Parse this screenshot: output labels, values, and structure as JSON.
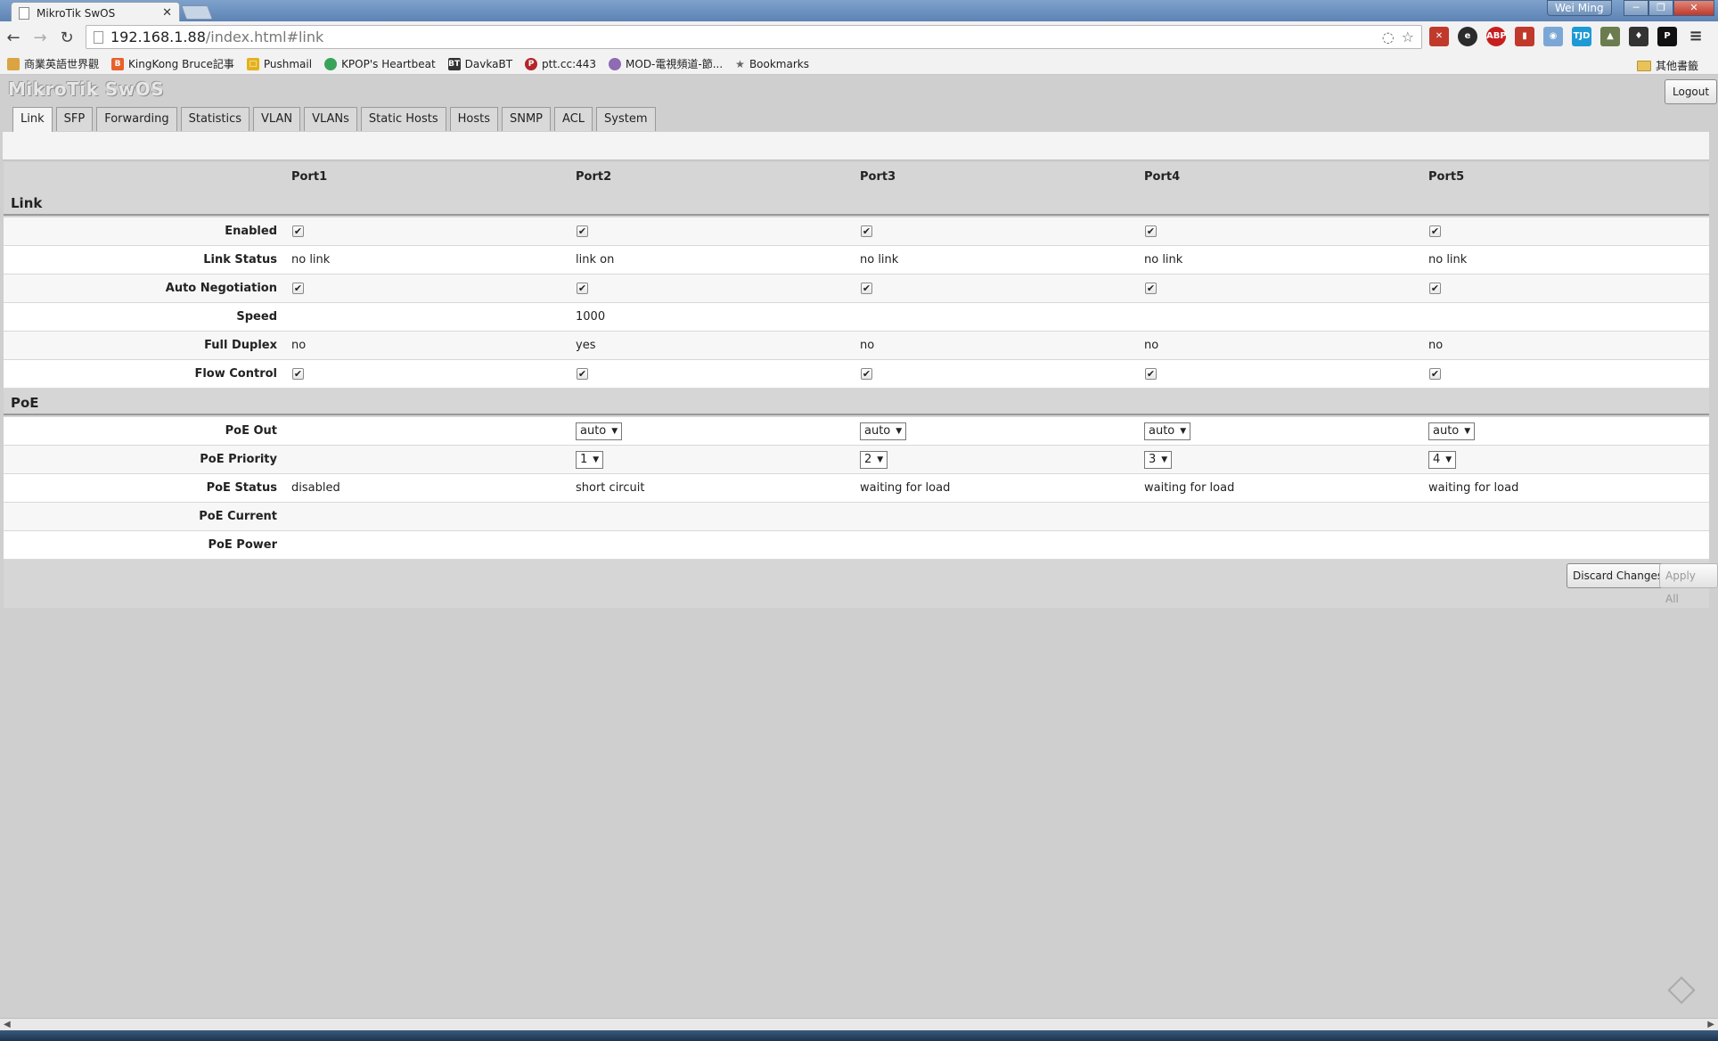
{
  "browser": {
    "tab_title": "MikroTik SwOS",
    "user": "Wei Ming",
    "url_host": "192.168.1.88",
    "url_path": "/index.html#link",
    "bookmarks": [
      {
        "label": "商業英語世界觀",
        "color": "#d9a441"
      },
      {
        "label": "KingKong Bruce記事",
        "color": "#e8612c"
      },
      {
        "label": "Pushmail",
        "color": "#e3b11a"
      },
      {
        "label": "KPOP's Heartbeat",
        "color": "#3aa35a"
      },
      {
        "label": "DavkaBT",
        "color": "#333333"
      },
      {
        "label": "ptt.cc:443",
        "color": "#b3262a"
      },
      {
        "label": "MOD-電視頻道-節...",
        "color": "#8f6bb3"
      },
      {
        "label": "Bookmarks",
        "color": "#666666"
      }
    ],
    "other_bookmarks": "其他書籤"
  },
  "app": {
    "logo": "MikroTik SwOS",
    "logout": "Logout",
    "tabs": [
      "Link",
      "SFP",
      "Forwarding",
      "Statistics",
      "VLAN",
      "VLANs",
      "Static Hosts",
      "Hosts",
      "SNMP",
      "ACL",
      "System"
    ],
    "active_tab": "Link",
    "ports": [
      "Port1",
      "Port2",
      "Port3",
      "Port4",
      "Port5"
    ],
    "sections": {
      "link": "Link",
      "poe": "PoE"
    },
    "rows": {
      "enabled": {
        "label": "Enabled",
        "values": [
          true,
          true,
          true,
          true,
          true
        ]
      },
      "link_status": {
        "label": "Link Status",
        "values": [
          "no link",
          "link on",
          "no link",
          "no link",
          "no link"
        ]
      },
      "auto_negotiation": {
        "label": "Auto Negotiation",
        "values": [
          true,
          true,
          true,
          true,
          true
        ]
      },
      "speed": {
        "label": "Speed",
        "values": [
          "",
          "1000",
          "",
          "",
          ""
        ]
      },
      "full_duplex": {
        "label": "Full Duplex",
        "values": [
          "no",
          "yes",
          "no",
          "no",
          "no"
        ]
      },
      "flow_control": {
        "label": "Flow Control",
        "values": [
          true,
          true,
          true,
          true,
          true
        ]
      },
      "poe_out": {
        "label": "PoE Out",
        "values": [
          "",
          "auto",
          "auto",
          "auto",
          "auto"
        ]
      },
      "poe_priority": {
        "label": "PoE Priority",
        "values": [
          "",
          "1",
          "2",
          "3",
          "4"
        ]
      },
      "poe_status": {
        "label": "PoE Status",
        "values": [
          "disabled",
          "short circuit",
          "waiting for load",
          "waiting for load",
          "waiting for load"
        ]
      },
      "poe_current": {
        "label": "PoE Current",
        "values": [
          "",
          "",
          "",
          "",
          ""
        ]
      },
      "poe_power": {
        "label": "PoE Power",
        "values": [
          "",
          "",
          "",
          "",
          ""
        ]
      }
    },
    "buttons": {
      "discard": "Discard Changes",
      "apply": "Apply All"
    },
    "checkmark": "✔"
  }
}
